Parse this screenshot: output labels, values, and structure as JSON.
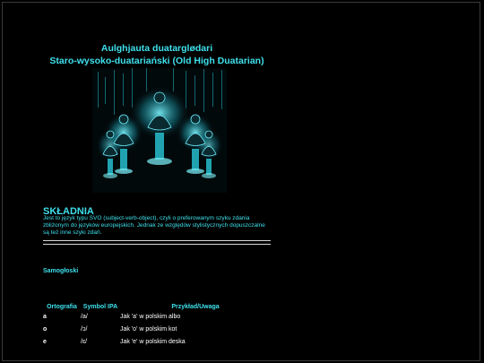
{
  "page": {
    "title_line1": "Aulghjauta duatarglødari",
    "title_line2": "Staro-wysoko-duatariański (Old High Duatarian)"
  },
  "colors": {
    "accent": "#3ee0ec",
    "background": "#000000",
    "text": "#ffffff"
  },
  "hero_image": {
    "icon": "meditating-figures-image"
  },
  "syntax": {
    "heading": "SKŁADNIA",
    "body": "Jest to język typu SVO (subject-verb-object), czyli o preferowanym szyku zdania zbliżonym do języków europejskich. Jednak ze względów stylistycznych dopuszczalne są też inne szyki zdań."
  },
  "vowels": {
    "heading": "Samogłoski",
    "columns": [
      "Ortografia",
      "Symbol IPA",
      "Przykład/Uwaga"
    ],
    "rows": [
      [
        "a",
        "/a/",
        "Jak 'a' w polskim albo"
      ],
      [
        "o",
        "/ɔ/",
        "Jak 'o' w polskim kot"
      ],
      [
        "e",
        "/ɛ/",
        "Jak 'e' w polskim deska"
      ]
    ]
  }
}
